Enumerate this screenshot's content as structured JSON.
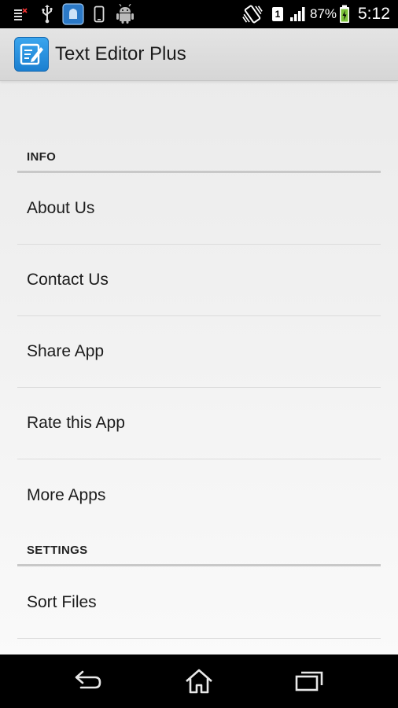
{
  "status_bar": {
    "battery": "87%",
    "time": "5:12",
    "sim_badge": "1",
    "icons": [
      "notification-icon",
      "usb-icon",
      "app-notification-icon",
      "phone-icon",
      "android-debug-icon",
      "vibrate-icon",
      "sim-icon",
      "signal-icon",
      "battery-charging-icon"
    ]
  },
  "action_bar": {
    "title": "Text Editor Plus",
    "icon": "text-editor-app-icon"
  },
  "sections": [
    {
      "header": "INFO",
      "items": [
        {
          "label": "About Us"
        },
        {
          "label": "Contact Us"
        },
        {
          "label": "Share App"
        },
        {
          "label": "Rate this App"
        },
        {
          "label": "More Apps"
        }
      ]
    },
    {
      "header": "SETTINGS",
      "items": [
        {
          "label": "Sort Files"
        }
      ]
    }
  ],
  "nav_bar": {
    "icons": [
      "back-icon",
      "home-icon",
      "recent-apps-icon"
    ]
  },
  "colors": {
    "status_bar_bg": "#000000",
    "action_bar_bg": "#dcdcdc",
    "app_icon_blue": "#2a90e0",
    "battery_green": "#7cc43a"
  }
}
